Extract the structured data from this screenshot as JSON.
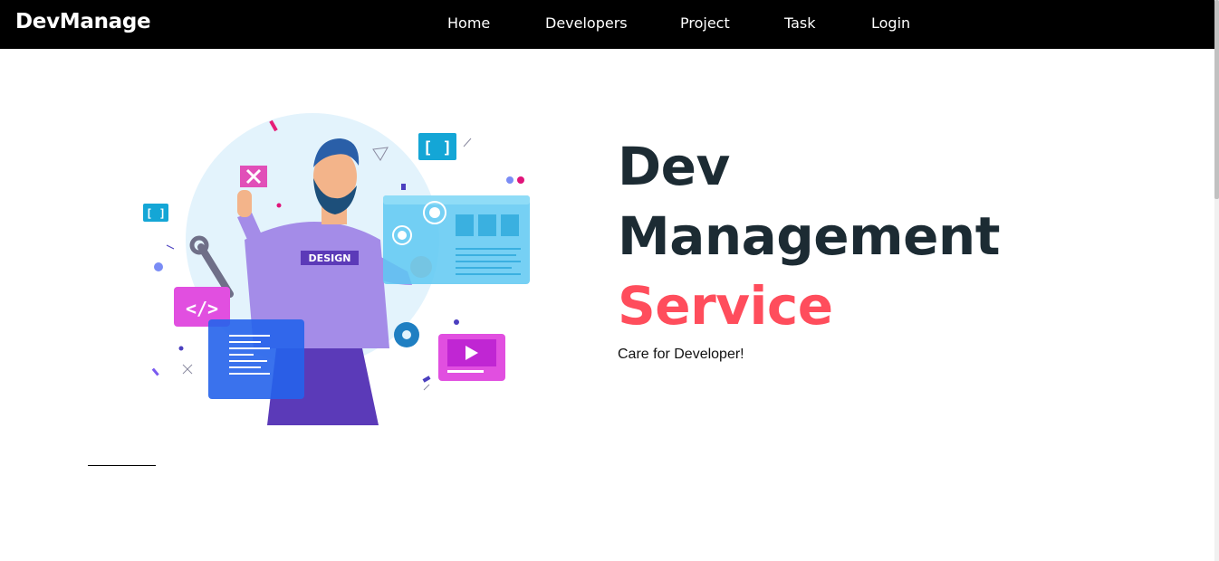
{
  "navbar": {
    "brand": "DevManage",
    "links": [
      {
        "label": "Home"
      },
      {
        "label": "Developers"
      },
      {
        "label": "Project"
      },
      {
        "label": "Task"
      },
      {
        "label": "Login"
      }
    ]
  },
  "hero": {
    "title_line1": "Dev",
    "title_line2": "Management",
    "title_accent": "Service",
    "subtitle": "Care for Developer!",
    "illustration_badge": "DESIGN"
  },
  "colors": {
    "navbar_bg": "#000000",
    "title": "#1c2b33",
    "accent": "#ff4d5c"
  }
}
